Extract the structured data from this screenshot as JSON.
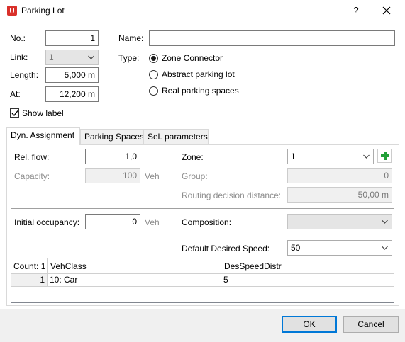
{
  "window": {
    "title": "Parking Lot",
    "help_glyph": "?"
  },
  "general": {
    "no_label": "No.:",
    "no_value": "1",
    "link_label": "Link:",
    "link_value": "1",
    "length_label": "Length:",
    "length_value": "5,000 m",
    "at_label": "At:",
    "at_value": "12,200 m",
    "name_label": "Name:",
    "name_value": "",
    "type_label": "Type:",
    "type_options": [
      "Zone Connector",
      "Abstract parking lot",
      "Real parking spaces"
    ],
    "type_selected": "Zone Connector",
    "show_label_text": "Show label",
    "show_label_checked": true
  },
  "tabs": [
    "Dyn. Assignment",
    "Parking Spaces",
    "Sel. parameters"
  ],
  "active_tab": "Dyn. Assignment",
  "dyn": {
    "rel_flow_label": "Rel. flow:",
    "rel_flow_value": "1,0",
    "capacity_label": "Capacity:",
    "capacity_value": "100",
    "capacity_unit": "Veh",
    "zone_label": "Zone:",
    "zone_value": "1",
    "group_label": "Group:",
    "group_value": "0",
    "routing_label": "Routing decision distance:",
    "routing_value": "50,00 m",
    "initial_occ_label": "Initial occupancy:",
    "initial_occ_value": "0",
    "initial_occ_unit": "Veh",
    "composition_label": "Composition:",
    "composition_value": "",
    "default_speed_label": "Default Desired Speed:",
    "default_speed_value": "50"
  },
  "grid": {
    "columns": [
      "Count: 1",
      "VehClass",
      "DesSpeedDistr"
    ],
    "rows": [
      {
        "index": "1",
        "vehclass": "10: Car",
        "desspeed": "5"
      }
    ]
  },
  "buttons": {
    "ok": "OK",
    "cancel": "Cancel"
  },
  "colors": {
    "accent": "#0078d7",
    "add_green": "#22a038",
    "app_icon_red": "#d9302a"
  },
  "icons": [
    "app-logo-icon",
    "help-icon",
    "close-icon",
    "chevron-down-icon",
    "add-icon",
    "check-icon"
  ]
}
